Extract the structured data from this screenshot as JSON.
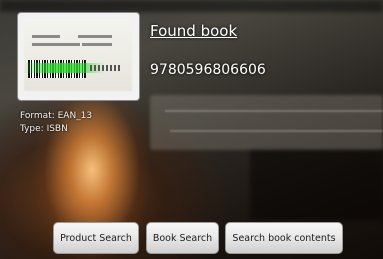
{
  "result": {
    "title": "Found book",
    "isbn": "9780596806606",
    "format_line": "Format: EAN_13",
    "type_line": "Type: ISBN"
  },
  "buttons": {
    "product_search": "Product Search",
    "book_search": "Book Search",
    "search_book_contents": "Search book contents"
  },
  "colors": {
    "button_face": "#e7e7e7",
    "button_text": "#1e1e1e",
    "overlay_text": "#ffffff",
    "scan_line": "#28dc28"
  }
}
